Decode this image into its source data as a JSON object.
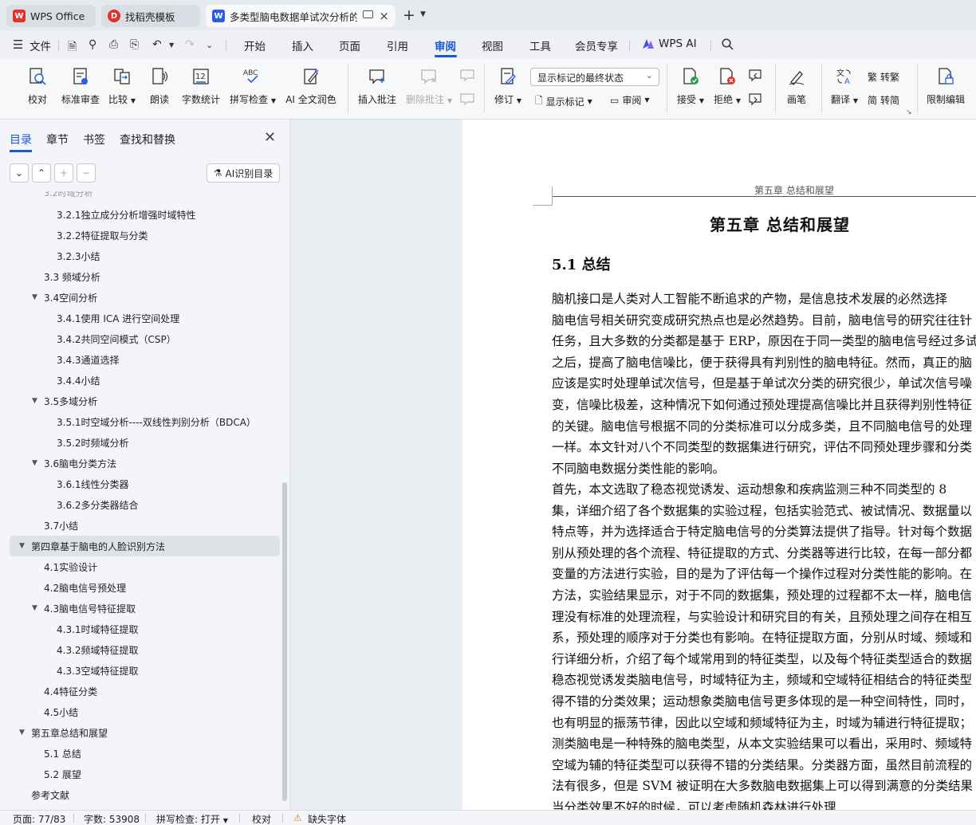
{
  "tabs": [
    {
      "label": "WPS Office",
      "logo": "W",
      "color": "#e0322b"
    },
    {
      "label": "找稻壳模板",
      "logo": "D",
      "color": "#e0322b"
    },
    {
      "label": "多类型脑电数据单试次分析的",
      "logo": "W",
      "color": "#2b5fe0"
    }
  ],
  "menu": {
    "file": "文件",
    "items": [
      "开始",
      "插入",
      "页面",
      "引用",
      "审阅",
      "视图",
      "工具",
      "会员专享"
    ],
    "active": "审阅",
    "wps_ai": "WPS AI"
  },
  "ribbon": {
    "proofread": "校对",
    "standard_review": "标准审查",
    "compare": "比较",
    "read_aloud": "朗读",
    "word_count": "字数统计",
    "spell_check": "拼写检查",
    "ai_polish": "AI 全文润色",
    "insert_comment": "插入批注",
    "delete_comment": "删除批注",
    "track_changes": "修订",
    "markup_dropdown": "显示标记的最终状态",
    "show_markup": "显示标记",
    "review": "审阅",
    "accept": "接受",
    "reject": "拒绝",
    "pen": "画笔",
    "translate": "翻译",
    "to_traditional": "转繁",
    "to_simplified": "转简",
    "restrict_edit": "限制编辑"
  },
  "nav": {
    "tabs": [
      "目录",
      "章节",
      "书签",
      "查找和替换"
    ],
    "active_tab": "目录",
    "ai_toc": "AI识别目录",
    "toc": [
      {
        "label": "3.2.1独立成分分析增强时域特性",
        "level": 3
      },
      {
        "label": "3.2.2特征提取与分类",
        "level": 3
      },
      {
        "label": "3.2.3小结",
        "level": 3
      },
      {
        "label": "3.3  频域分析",
        "level": 2
      },
      {
        "label": "3.4空间分析",
        "level": 2,
        "expanded": true
      },
      {
        "label": "3.4.1使用 ICA 进行空间处理",
        "level": 3
      },
      {
        "label": "3.4.2共同空间模式（CSP）",
        "level": 3
      },
      {
        "label": "3.4.3通道选择",
        "level": 3
      },
      {
        "label": "3.4.4小结",
        "level": 3
      },
      {
        "label": "3.5多域分析",
        "level": 2,
        "expanded": true
      },
      {
        "label": "3.5.1时空域分析----双线性判别分析（BDCA）",
        "level": 3
      },
      {
        "label": "3.5.2时频域分析",
        "level": 3
      },
      {
        "label": "3.6脑电分类方法",
        "level": 2,
        "expanded": true
      },
      {
        "label": "3.6.1线性分类器",
        "level": 3
      },
      {
        "label": "3.6.2多分类器结合",
        "level": 3
      },
      {
        "label": "3.7小结",
        "level": 2
      },
      {
        "label": "第四章基于脑电的人脸识别方法",
        "level": 1,
        "expanded": true,
        "selected": true
      },
      {
        "label": "4.1实验设计",
        "level": 2
      },
      {
        "label": "4.2脑电信号预处理",
        "level": 2
      },
      {
        "label": "4.3脑电信号特征提取",
        "level": 2,
        "expanded": true
      },
      {
        "label": "4.3.1时域特征提取",
        "level": 3
      },
      {
        "label": "4.3.2频域特征提取",
        "level": 3
      },
      {
        "label": "4.3.3空域特征提取",
        "level": 3
      },
      {
        "label": "4.4特征分类",
        "level": 2
      },
      {
        "label": "4.5小结",
        "level": 2
      },
      {
        "label": "第五章总结和展望",
        "level": 1,
        "expanded": true
      },
      {
        "label": "5.1  总结",
        "level": 2
      },
      {
        "label": "5.2  展望",
        "level": 2
      },
      {
        "label": "参考文献",
        "level": 1
      }
    ]
  },
  "document": {
    "header": "第五章  总结和展望",
    "chapter_title": "第五章   总结和展望",
    "section_title": "5.1  总结",
    "paragraph1": [
      "    脑机接口是人类对人工智能不断追求的产物，是信息技术发展的必然选择",
      "脑电信号相关研究变成研究热点也是必然趋势。目前，脑电信号的研究往往针",
      "任务，且大多数的分类都是基于 ERP，原因在于同一类型的脑电信号经过多试",
      "之后，提高了脑电信噪比，便于获得具有判别性的脑电特征。然而，真正的脑",
      "应该是实时处理单试次信号，但是基于单试次分类的研究很少，单试次信号噪",
      "变，信噪比极差，这种情况下如何通过预处理提高信噪比并且获得判别性特征",
      "的关键。脑电信号根据不同的分类标准可以分成多类，且不同脑电信号的处理",
      "一样。本文针对八个不同类型的数据集进行研究，评估不同预处理步骤和分类",
      "不同脑电数据分类性能的影响。"
    ],
    "paragraph2": [
      "    首先，本文选取了稳态视觉诱发、运动想象和疾病监测三种不同类型的 8",
      "集，详细介绍了各个数据集的实验过程，包括实验范式、被试情况、数据量以",
      "特点等，并为选择适合于特定脑电信号的分类算法提供了指导。针对每个数据",
      "别从预处理的各个流程、特征提取的方式、分类器等进行比较，在每一部分都",
      "变量的方法进行实验，目的是为了评估每一个操作过程对分类性能的影响。在",
      "方法，实验结果显示，对于不同的数据集，预处理的过程都不太一样，脑电信",
      "理没有标准的处理流程，与实验设计和研究目的有关，且预处理之间存在相互",
      "系，预处理的顺序对于分类也有影响。在特征提取方面，分别从时域、频域和",
      "行详细分析，介绍了每个域常用到的特征类型，以及每个特征类型适合的数据",
      "稳态视觉诱发类脑电信号，时域特征为主，频域和空域特征相结合的特征类型",
      "得不错的分类效果；运动想象类脑电信号更多体现的是一种空间特性，同时，",
      "也有明显的振荡节律，因此以空域和频域特征为主，时域为辅进行特征提取；",
      "测类脑电是一种特殊的脑电类型，从本文实验结果可以看出，采用时、频域特",
      "空域为辅的特征类型可以获得不错的分类结果。分类器方面，虽然目前流程的",
      "法有很多，但是 SVM 被证明在大多数脑电数据集上可以得到满意的分类结果",
      "当分类效果不好的时候，可以考虑随机森林进行处理"
    ]
  },
  "status": {
    "page": "页面: 77/83",
    "words": "字数: 53908",
    "spell": "拼写检查: 打开",
    "proof": "校对",
    "missing_font": "缺失字体"
  }
}
